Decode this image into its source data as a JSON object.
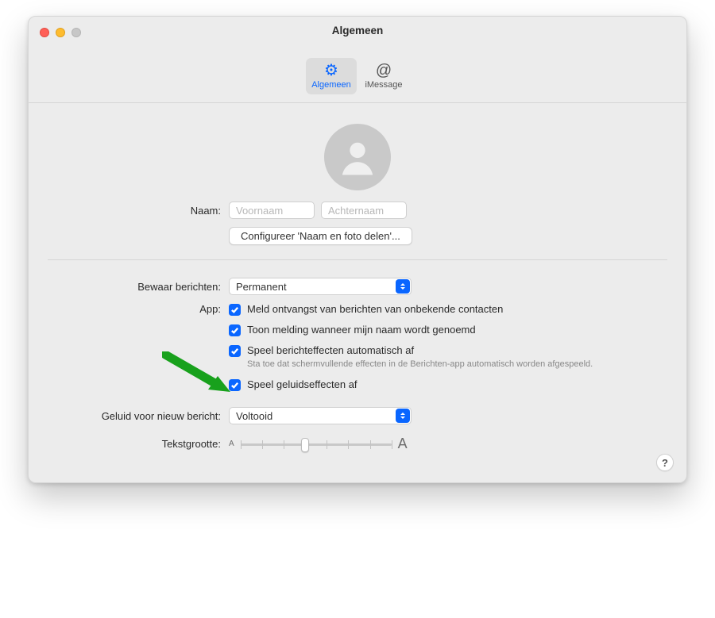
{
  "window": {
    "title": "Algemeen"
  },
  "tabs": {
    "general": {
      "label": "Algemeen"
    },
    "imessage": {
      "label": "iMessage"
    }
  },
  "profile": {
    "name_label": "Naam:",
    "first_placeholder": "Voornaam",
    "last_placeholder": "Achternaam",
    "configure_button": "Configureer 'Naam en foto delen'..."
  },
  "keep_messages": {
    "label": "Bewaar berichten:",
    "value": "Permanent"
  },
  "app": {
    "label": "App:",
    "opt_unknown": "Meld ontvangst van berichten van onbekende contacten",
    "opt_name_mention": "Toon melding wanneer mijn naam wordt genoemd",
    "opt_autoplay_effects": "Speel berichteffecten automatisch af",
    "opt_autoplay_effects_hint": "Sta toe dat schermvullende effecten in de Berichten-app automatisch worden afgespeeld.",
    "opt_sound_effects": "Speel geluidseffecten af"
  },
  "new_msg_sound": {
    "label": "Geluid voor nieuw bericht:",
    "value": "Voltooid"
  },
  "text_size": {
    "label": "Tekstgrootte:",
    "small_a": "A",
    "big_a": "A"
  },
  "help": {
    "label": "?"
  }
}
